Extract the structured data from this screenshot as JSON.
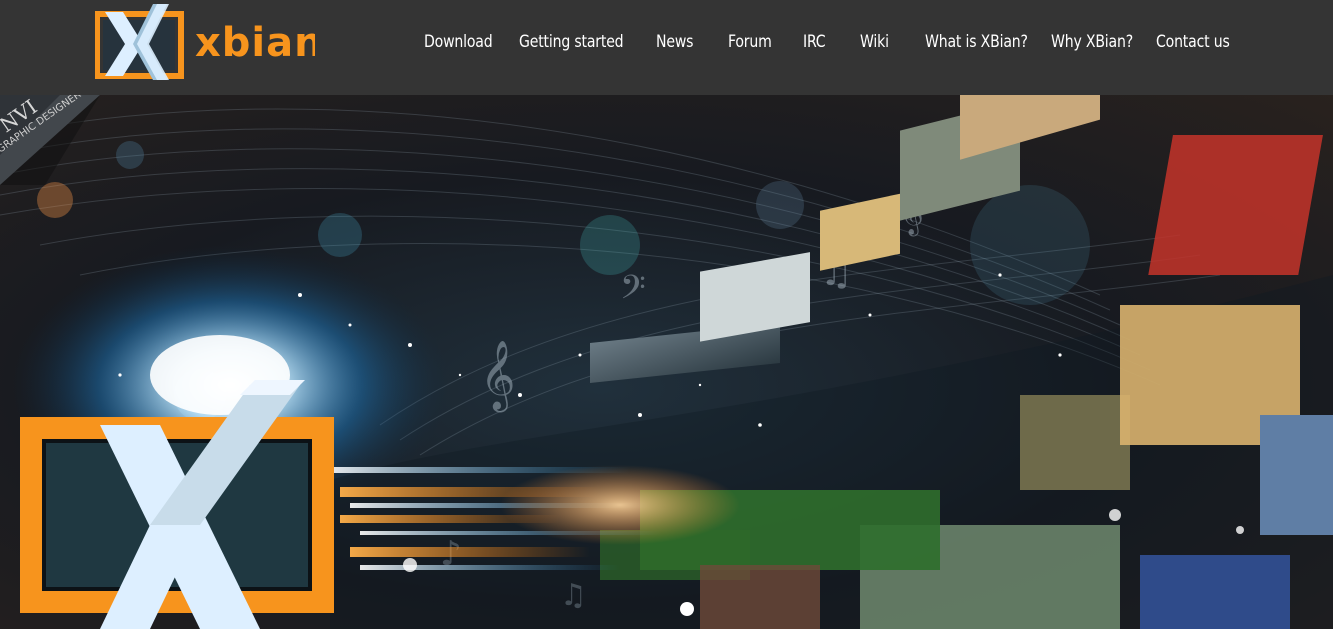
{
  "header": {
    "logo_text": "xbian",
    "logo_mark": "X",
    "nav": [
      {
        "label": "Download",
        "name": "nav-download"
      },
      {
        "label": "Getting started",
        "name": "nav-getting-started"
      },
      {
        "label": "News",
        "name": "nav-news"
      },
      {
        "label": "Forum",
        "name": "nav-forum"
      },
      {
        "label": "IRC",
        "name": "nav-irc"
      },
      {
        "label": "Wiki",
        "name": "nav-wiki"
      },
      {
        "label": "What is XBian?",
        "name": "nav-what-is-xbian"
      },
      {
        "label": "Why XBian?",
        "name": "nav-why-xbian"
      },
      {
        "label": "Contact us",
        "name": "nav-contact-us"
      }
    ]
  },
  "hero": {
    "corner_badge_line1": "NVI",
    "corner_badge_line2": "GRAPHIC DESIGNER",
    "slider": {
      "total_slides": 1,
      "active_slide": 1
    }
  },
  "colors": {
    "brand_orange": "#F7941D",
    "header_bg": "#343434",
    "logo_x_light": "#DDEFFF",
    "nav_text": "#FFFFFF"
  }
}
